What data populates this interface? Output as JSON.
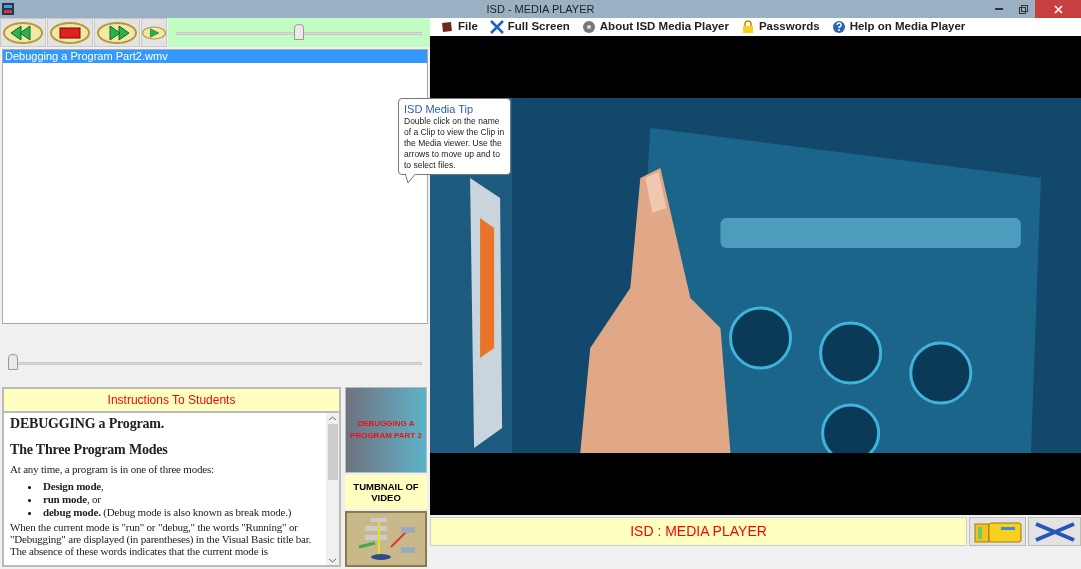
{
  "window": {
    "title": "ISD - MEDIA PLAYER"
  },
  "toolbar": {
    "buttons": [
      {
        "kind": "back"
      },
      {
        "kind": "stop"
      },
      {
        "kind": "forward"
      },
      {
        "kind": "play"
      }
    ],
    "volume": {
      "level": 0.5
    }
  },
  "playlist": [
    {
      "label": "Debugging a Program Part2.wmv",
      "selected": true
    }
  ],
  "position": {
    "level": 0
  },
  "instructions": {
    "title": "Instructions To Students",
    "heading": "DEBUGGING a Program.",
    "subheading": "The Three Program Modes",
    "intro": "At any time, a program is in one of three modes:",
    "bullets": [
      "**Design mode**,",
      "**run mode**, or",
      "**debug mode.** (Debug mode is also known as break mode.)"
    ],
    "body": "When the current mode is \"run\" or \"debug,\" the words \"Running\" or \"Debugging\" are displayed (in parentheses) in the Visual Basic title bar. The absence of these words indicates that the current mode is"
  },
  "thumbnail": {
    "slide_title": "DEBUGGING A PROGRAM PART 2",
    "caption": "TUMBNAIL OF VIDEO"
  },
  "menu": [
    {
      "label": "File",
      "kind": "file"
    },
    {
      "label": "Full Screen",
      "kind": "fullscreen"
    },
    {
      "label": "About ISD Media Player",
      "kind": "about"
    },
    {
      "label": "Passwords",
      "kind": "passwords"
    },
    {
      "label": "Help on Media Player",
      "kind": "help"
    }
  ],
  "tooltip": {
    "title": "ISD Media Tip",
    "text": "Double click on the name of a Clip to view the Clip in the Media viewer. Use the arrows to move up and to to select files."
  },
  "status_bar": {
    "title": "ISD : MEDIA PLAYER"
  }
}
